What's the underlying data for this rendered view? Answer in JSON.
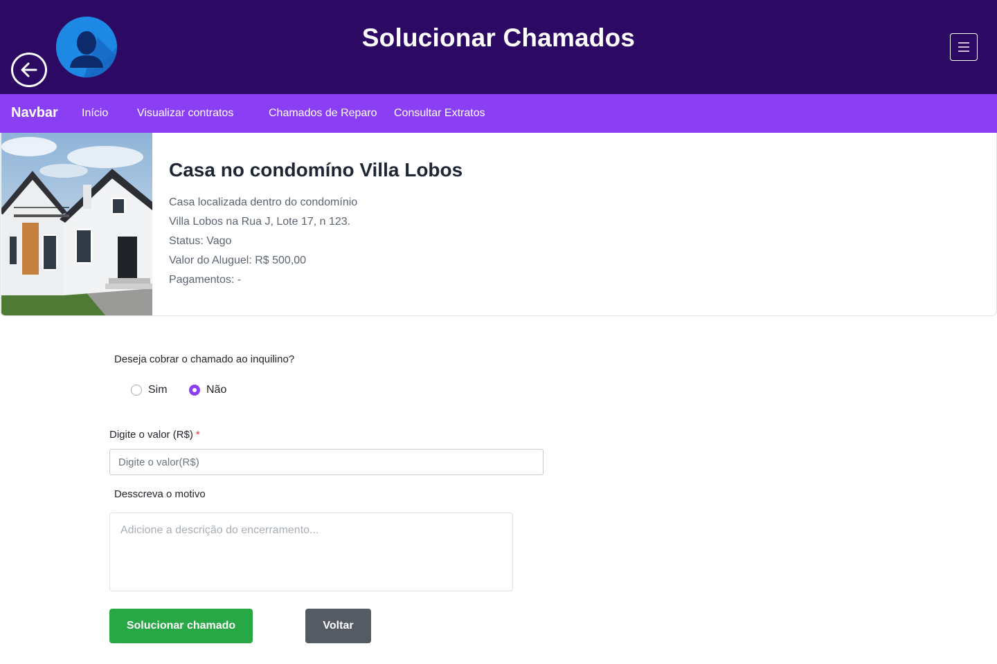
{
  "header": {
    "title": "Solucionar Chamados",
    "back_icon": "arrow-left-circle-icon",
    "avatar_icon": "user-avatar-icon",
    "menu_icon": "hamburger-menu-icon"
  },
  "navbar": {
    "brand": "Navbar",
    "links": [
      "Início",
      "Visualizar contratos",
      "Chamados de Reparo",
      "Consultar Extratos"
    ]
  },
  "property": {
    "title": "Casa no condomíno Villa Lobos",
    "lines": [
      "Casa localizada dentro do condomínio",
      "Villa Lobos na Rua J, Lote 17, n 123.",
      "Status: Vago",
      "Valor do Aluguel: R$ 500,00",
      "Pagamentos: -"
    ]
  },
  "form": {
    "question": "Deseja cobrar o chamado ao inquilino?",
    "options": [
      "Sim",
      "Não"
    ],
    "selected": "Não",
    "value_label": "Digite o valor (R$)",
    "required_mark": "*",
    "value_placeholder": "Digite o valor(R$)",
    "motivo_label": "Desscreva o motivo",
    "motivo_placeholder": "Adicione a descrição do encerramento...",
    "submit_label": "Solucionar chamado",
    "back_label": "Voltar"
  },
  "colors": {
    "header_bg": "#2c0a63",
    "navbar_bg": "#8b3ff5",
    "success": "#28a745",
    "secondary": "#545b62"
  }
}
